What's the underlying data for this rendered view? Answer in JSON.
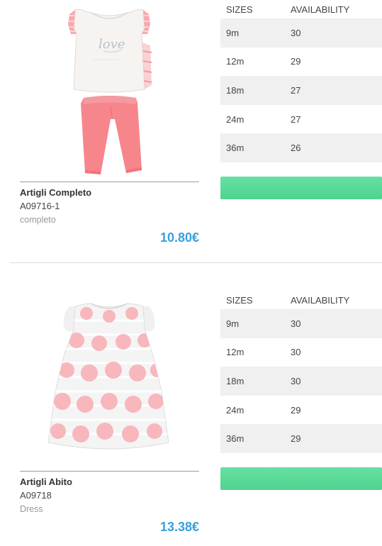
{
  "colors": {
    "price": "#3aa0dc",
    "button": "#5ad998",
    "row_stripe": "#f0f0f0"
  },
  "products": [
    {
      "name": "Artigli Completo",
      "code": "A09716-1",
      "type": "completo",
      "price": "10.80€",
      "image_icon": "outfit-top-and-leggings-image",
      "table": {
        "size_header": "SIZES",
        "availability_header": "AVAILABILITY",
        "rows": [
          {
            "size": "9m",
            "qty": "30"
          },
          {
            "size": "12m",
            "qty": "29"
          },
          {
            "size": "18m",
            "qty": "27"
          },
          {
            "size": "24m",
            "qty": "27"
          },
          {
            "size": "36m",
            "qty": "26"
          }
        ]
      },
      "button_label": ""
    },
    {
      "name": "Artigli Abito",
      "code": "A09718",
      "type": "Dress",
      "price": "13.38€",
      "image_icon": "polka-dot-dress-image",
      "table": {
        "size_header": "SIZES",
        "availability_header": "AVAILABILITY",
        "rows": [
          {
            "size": "9m",
            "qty": "30"
          },
          {
            "size": "12m",
            "qty": "30"
          },
          {
            "size": "18m",
            "qty": "30"
          },
          {
            "size": "24m",
            "qty": "29"
          },
          {
            "size": "36m",
            "qty": "29"
          }
        ]
      },
      "button_label": ""
    }
  ]
}
